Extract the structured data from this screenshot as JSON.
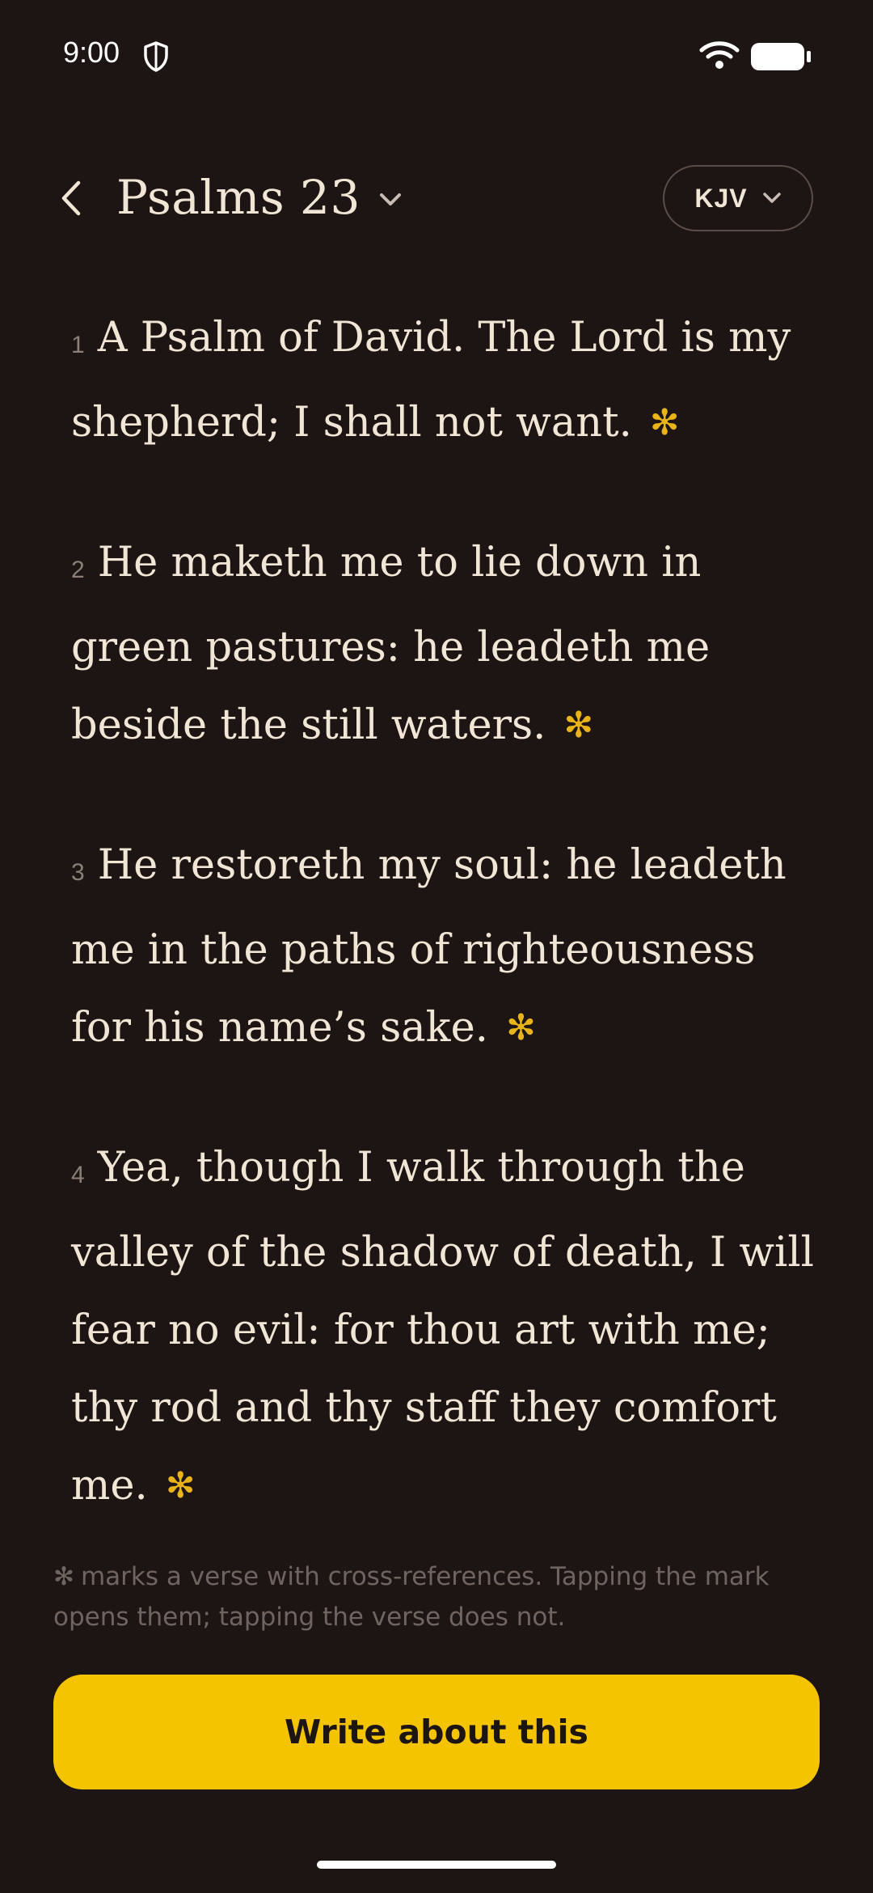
{
  "status_bar": {
    "time": "9:00"
  },
  "header": {
    "back_icon": "chevron-left-icon",
    "chapter_title": "Psalms 23",
    "version_label": "KJV"
  },
  "colors": {
    "background": "#1d1513",
    "text": "#f1e6d6",
    "accent": "#f4c400",
    "xref_mark": "#e8b41a",
    "muted": "#6f6460"
  },
  "verses": [
    {
      "number": "1",
      "text": "A Psalm of David. The Lord is my shepherd; I shall not want.",
      "mark": "✻"
    },
    {
      "number": "2",
      "text": "He maketh me to lie down in green pastures: he leadeth me beside the still waters.",
      "mark": "✻"
    },
    {
      "number": "3",
      "text": "He restoreth my soul: he leadeth me in the paths of righteousness for his name’s sake.",
      "mark": "✻"
    },
    {
      "number": "4",
      "text": "Yea, though I walk through the valley of the shadow of death, I will fear no evil: for thou art with me; thy rod and thy staff they comfort me.",
      "mark": "✻"
    }
  ],
  "footnote": {
    "mark": "✻",
    "text": "marks a verse with cross-references. Tapping the mark opens them; tapping the verse does not."
  },
  "cta": {
    "label": "Write about this"
  }
}
